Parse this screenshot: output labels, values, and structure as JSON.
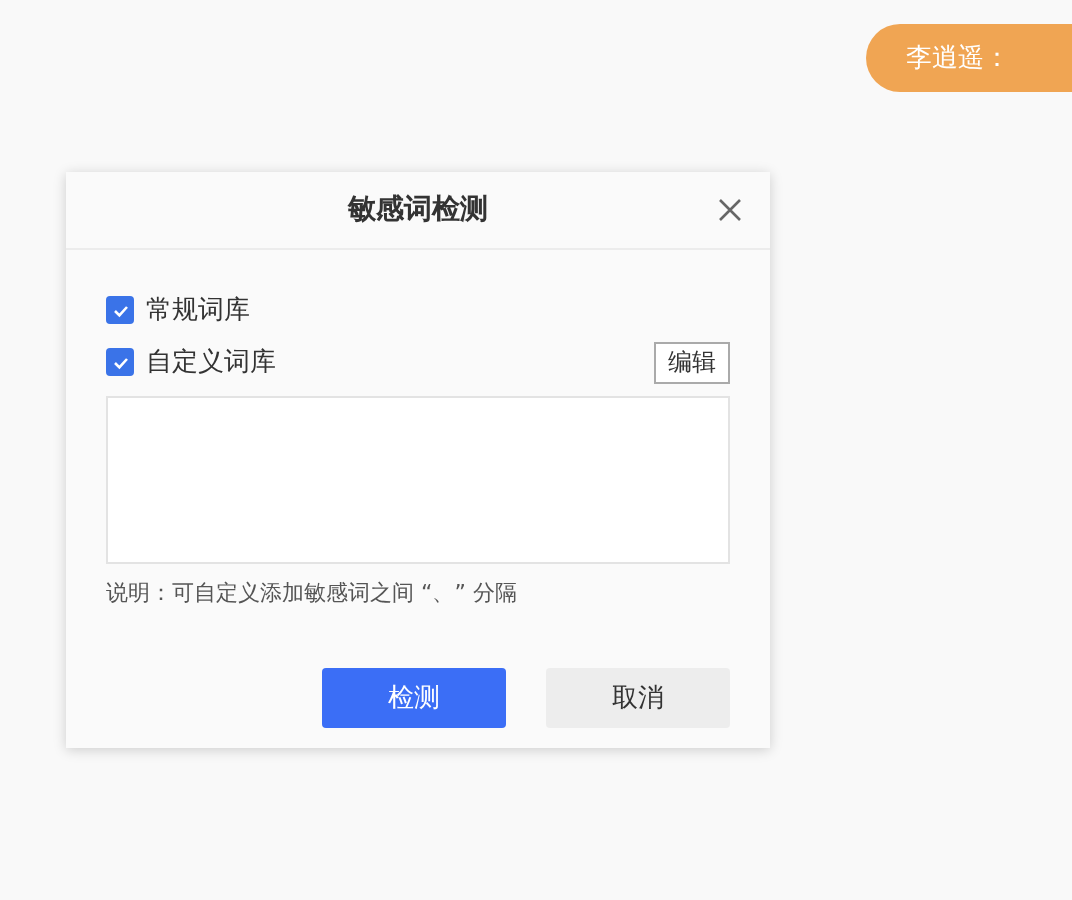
{
  "chat_bubble": {
    "text": "李逍遥："
  },
  "dialog": {
    "title": "敏感词检测",
    "options": [
      {
        "label": "常规词库",
        "checked": true
      },
      {
        "label": "自定义词库",
        "checked": true
      }
    ],
    "edit_button": "编辑",
    "note": "说明：可自定义添加敏感词之间 “、” 分隔",
    "buttons": [
      {
        "label": "检测",
        "kind": "primary"
      },
      {
        "label": "取消",
        "kind": "secondary"
      }
    ]
  }
}
